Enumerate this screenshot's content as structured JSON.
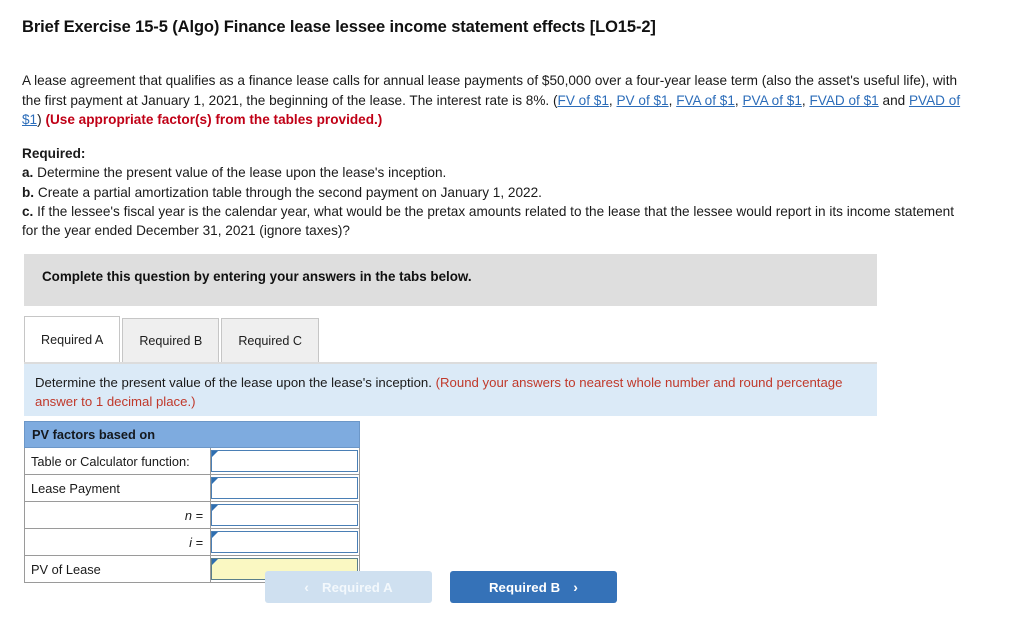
{
  "exercise": {
    "title": "Brief Exercise 15-5 (Algo) Finance lease lessee income statement effects [LO15-2]"
  },
  "problem": {
    "segment_1": "A lease agreement that qualifies as a finance lease calls for annual lease payments of $50,000 over a four-year lease term (also the asset's useful life), with the first payment at January 1, 2021, the beginning of the lease. The interest rate is 8%. (",
    "links": [
      "FV of $1",
      "PV of $1",
      "FVA of $1",
      "PVA of $1",
      "FVAD of $1",
      "PVAD of $1"
    ],
    "separator": ", ",
    "and_word": " and ",
    "close_paren": ") ",
    "emphasis": "(Use appropriate factor(s) from the tables provided.)"
  },
  "required": {
    "heading": "Required:",
    "items": [
      {
        "marker": "a.",
        "text": " Determine the present value of the lease upon the lease's inception."
      },
      {
        "marker": "b.",
        "text": " Create a partial amortization table through the second payment on January 1, 2022."
      },
      {
        "marker": "c.",
        "text": " If the lessee's fiscal year is the calendar year, what would be the pretax amounts related to the lease that the lessee would report in its income statement for the year ended December 31, 2021 (ignore taxes)?"
      }
    ]
  },
  "banner": {
    "text": "Complete this question by entering your answers in the tabs below."
  },
  "tabs": [
    {
      "label": "Required A",
      "active": true
    },
    {
      "label": "Required B",
      "active": false
    },
    {
      "label": "Required C",
      "active": false
    }
  ],
  "instruction": {
    "main": "Determine the present value of the lease upon the lease's inception. ",
    "note": "(Round your answers to nearest whole number and round percentage answer to 1 decimal place.)"
  },
  "answer_table": {
    "header": "PV factors based on",
    "rows": [
      {
        "label": "Table or Calculator function:",
        "align": "left",
        "value": "",
        "style": "normal"
      },
      {
        "label": "Lease Payment",
        "align": "left",
        "value": "",
        "style": "normal"
      },
      {
        "label": "n =",
        "align": "right",
        "value": "",
        "style": "normal"
      },
      {
        "label": "i =",
        "align": "right",
        "value": "",
        "style": "normal"
      },
      {
        "label": "PV of Lease",
        "align": "left",
        "value": "",
        "style": "yellow"
      }
    ]
  },
  "navigation": {
    "prev_label": "Required A",
    "prev_chevron": "‹",
    "next_label": "Required B",
    "next_chevron": "›"
  },
  "colors": {
    "header_blue": "#7eabdf",
    "banner_gray": "#dedede",
    "instruction_blue": "#dbeaf7",
    "accent_blue": "#3572b8",
    "disabled_blue": "#cfe0f0",
    "link_blue": "#2b6cb9",
    "red": "#c00016",
    "note_red": "#c0392b",
    "yellow_field": "#faf8c2"
  }
}
